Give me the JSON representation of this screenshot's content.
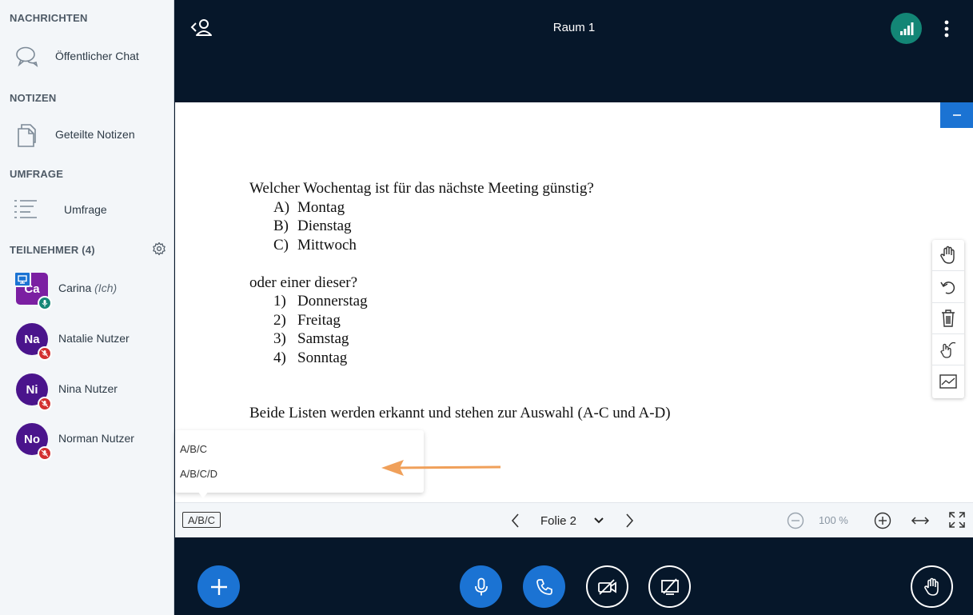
{
  "sidebar": {
    "messages": {
      "title": "NACHRICHTEN",
      "public_chat": "Öffentlicher Chat",
      "chat_icon": "chat-bubbles-icon"
    },
    "notes": {
      "title": "NOTIZEN",
      "shared_notes": "Geteilte Notizen",
      "notes_icon": "notes-icon"
    },
    "poll": {
      "title": "UMFRAGE",
      "poll_label": "Umfrage",
      "poll_icon": "list-icon"
    },
    "participants": {
      "title": "TEILNEHMER (4)",
      "users": [
        {
          "initials": "Ca",
          "name": "Carina",
          "suffix": "(Ich)",
          "color": "#7b1fa2",
          "shape": "square",
          "mic": "on",
          "presenter": true
        },
        {
          "initials": "Na",
          "name": "Natalie Nutzer",
          "color": "#4a148c",
          "shape": "round",
          "mic": "muted"
        },
        {
          "initials": "Ni",
          "name": "Nina Nutzer",
          "color": "#4a148c",
          "shape": "round",
          "mic": "muted"
        },
        {
          "initials": "No",
          "name": "Norman Nutzer",
          "color": "#4a148c",
          "shape": "round",
          "mic": "muted"
        }
      ]
    }
  },
  "header": {
    "title": "Raum 1"
  },
  "slide": {
    "question1": "Welcher Wochentag ist für das nächste Meeting günstig?",
    "list1": [
      {
        "marker": "A)",
        "text": "Montag"
      },
      {
        "marker": "B)",
        "text": "Dienstag"
      },
      {
        "marker": "C)",
        "text": "Mittwoch"
      }
    ],
    "question2": "oder einer dieser?",
    "list2": [
      {
        "marker": "1)",
        "text": "Donnerstag"
      },
      {
        "marker": "2)",
        "text": "Freitag"
      },
      {
        "marker": "3)",
        "text": "Samstag"
      },
      {
        "marker": "4)",
        "text": "Sonntag"
      }
    ],
    "footer": "Beide Listen werden erkannt und stehen zur Auswahl (A-C und A-D)"
  },
  "quick_poll": {
    "button_label": "A/B/C",
    "options": [
      "A/B/C",
      "A/B/C/D"
    ]
  },
  "slide_controls": {
    "slide_label": "Folie 2",
    "zoom": "100 %"
  },
  "colors": {
    "accent": "#1b73d3",
    "connection": "#138676",
    "muted": "#d32f2f",
    "dark_bg": "#06172a",
    "arrow": "#f0a05a"
  }
}
